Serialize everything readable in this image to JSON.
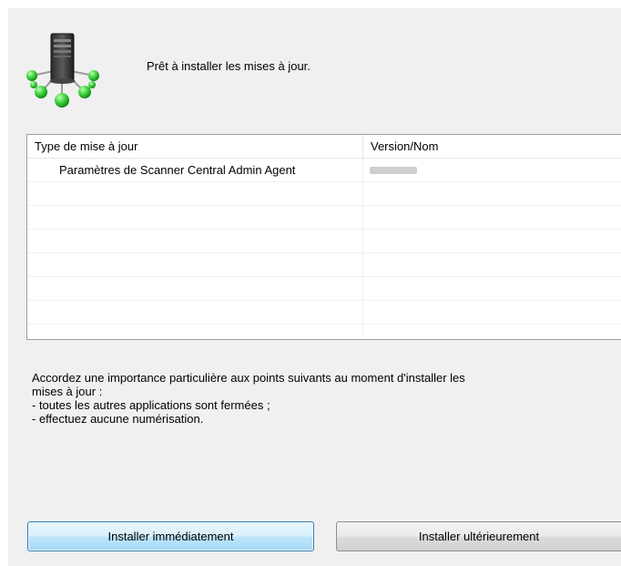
{
  "header": {
    "status_text": "Prêt à installer les mises à jour."
  },
  "table": {
    "columns": [
      "Type de mise à jour",
      "Version/Nom"
    ],
    "rows": [
      {
        "type": "Paramètres de Scanner Central Admin Agent",
        "version": ""
      }
    ],
    "empty_rows": 7
  },
  "notes": {
    "line1": "Accordez une importance particulière aux points suivants au moment d'installer les",
    "line2": "mises à jour :",
    "line3": "- toutes les autres applications sont fermées ;",
    "line4": "- effectuez aucune numérisation."
  },
  "buttons": {
    "install_now": "Installer immédiatement",
    "install_later": "Installer ultérieurement"
  },
  "icons": {
    "header": "server-network-icon"
  },
  "colors": {
    "dialog_bg": "#f0f0f0",
    "node_green": "#3fd23f",
    "primary_button_border": "#3c7fb1"
  }
}
